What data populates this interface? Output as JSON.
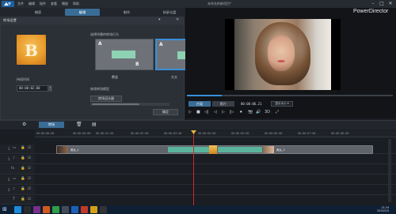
{
  "app": {
    "brand": "PowerDirector",
    "doc_title": "未命名的新项目*",
    "menus": [
      "文件",
      "编辑",
      "插件",
      "查看",
      "播放",
      "帮助"
    ],
    "window_controls": [
      "–",
      "□",
      "✕"
    ]
  },
  "tabs": [
    {
      "label": "捕获",
      "active": false
    },
    {
      "label": "编辑",
      "active": true
    },
    {
      "label": "制作",
      "active": false
    },
    {
      "label": "刻录光盘",
      "active": false
    }
  ],
  "panel": {
    "title": "转场设置",
    "thumb_letter": "B",
    "duration_label": "持续时间",
    "duration_value": "00:00:02:00",
    "behavior_label": "选择所需的转场行为",
    "options": [
      {
        "letter_a": "A",
        "letter_b": "B",
        "label": "覆盖",
        "selected": false
      },
      {
        "letter_a": "A",
        "letter_b": "B",
        "label": "交叉",
        "selected": true
      }
    ],
    "mode_label": "修改转场模型",
    "mode_value": "转场设计器",
    "ok": "确定"
  },
  "preview": {
    "mode_clip": "片段",
    "mode_movie": "影片",
    "timecode": "00:00:06.21",
    "size_select": "显示大小 ▾",
    "controls": [
      "▷",
      "■",
      "◁|",
      "◁",
      "▷",
      "|▷",
      "⏺",
      "📷",
      "🔊",
      "3D",
      "⤢"
    ],
    "progress": 0.17
  },
  "toolbar": {
    "primary": "转场",
    "icons": [
      "⚙",
      "🗑",
      "▤"
    ]
  },
  "timeline": {
    "ticks": [
      "00:00:00:00",
      "00:00:00:00",
      "00:00:01:00",
      "00:00:02:00",
      "00:00:03:00",
      "00:00:04:00",
      "00:00:05:00",
      "00:00:06:00",
      "00:00:07:00",
      "00:00:08:00"
    ],
    "tracks": [
      {
        "num": "1",
        "type": "▭"
      },
      {
        "num": "1",
        "type": "♪"
      },
      {
        "num": "",
        "type": "fx"
      },
      {
        "num": "2",
        "type": "▭"
      },
      {
        "num": "2",
        "type": "♪"
      },
      {
        "num": "",
        "type": "T"
      }
    ],
    "clip_a_label": "美女_1",
    "clip_b_label": "美女_2"
  },
  "taskbar": {
    "apps": [
      "#1f8ad6",
      "#2b2b2b",
      "#7a2f8a",
      "#d25a1e",
      "#2f9e44",
      "#444b57",
      "#1e5fb4",
      "#c0392b",
      "#d4a017",
      "#333"
    ],
    "time": "21:19",
    "date": "2024/1/5"
  }
}
